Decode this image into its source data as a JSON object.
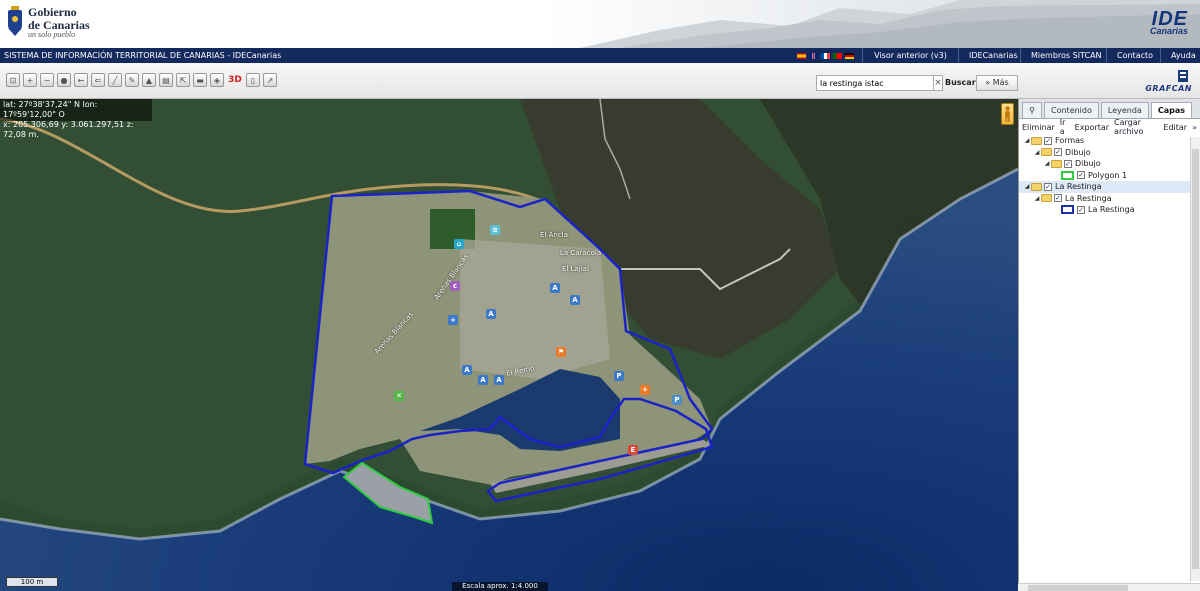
{
  "header": {
    "logo_line1": "Gobierno",
    "logo_line2": "de Canarias",
    "logo_tagline": "un solo pueblo",
    "ide_logo": "IDE",
    "ide_sub": "Canarias"
  },
  "navbar": {
    "system_title": "SISTEMA DE INFORMACIÓN TERRITORIAL DE CANARIAS - IDECanarias",
    "flags": [
      "es-flag",
      "en-flag",
      "fr-flag",
      "pt-flag",
      "de-flag"
    ],
    "links": [
      "Visor anterior (v3)",
      "IDECanarias",
      "Miembros SITCAN",
      "Contacto",
      "Ayuda"
    ]
  },
  "toolbar": {
    "tools": [
      "zoom-extent",
      "zoom-in",
      "zoom-out",
      "globe",
      "back",
      "forward",
      "measure-line",
      "draw",
      "profile",
      "print",
      "export",
      "compare",
      "layers",
      "3D",
      "split",
      "share"
    ],
    "tool_3d_label": "3D",
    "search_value": "la restinga istac",
    "clear_label": "×",
    "search_button": "Buscar",
    "more_button": "Más",
    "grafcan_label": "GRAFCAN"
  },
  "map": {
    "coord_line1": "lat:  27º38'37,24\" N  lon: 17º59'12,00\" O",
    "coord_line2": "x: 205.306,69  y: 3.061.297,51  z: 72,08 m.",
    "scale_bar": "100 m",
    "scale_text": "Escala aprox. 1:4.000",
    "streets": [
      "El Ancla",
      "La Caracola",
      "El Lajial",
      "Arenas Blancas",
      "Arenas Blancas",
      "El Remo"
    ]
  },
  "panel": {
    "tabs": [
      "Contenido",
      "Leyenda",
      "Capas"
    ],
    "active_tab": "Capas",
    "actions": [
      "Eliminar",
      "Ir a",
      "Exportar",
      "Cargar archivo",
      "Editar"
    ],
    "tree": [
      {
        "label": "Formas",
        "level": 0,
        "type": "folder"
      },
      {
        "label": "Dibujo",
        "level": 1,
        "type": "folder"
      },
      {
        "label": "Dibujo",
        "level": 2,
        "type": "folder"
      },
      {
        "label": "Polygon 1",
        "level": 3,
        "type": "layer",
        "swatch": "#2ecc40"
      },
      {
        "label": "La Restinga",
        "level": 0,
        "type": "folder",
        "selected": true
      },
      {
        "label": "La Restinga",
        "level": 1,
        "type": "folder"
      },
      {
        "label": "La Restinga",
        "level": 2,
        "type": "layer",
        "swatch": "#1e2fa8"
      }
    ]
  },
  "colors": {
    "nav_blue": "#14295c",
    "boundary": "#1a23c8",
    "polygon": "#2ecc40"
  }
}
